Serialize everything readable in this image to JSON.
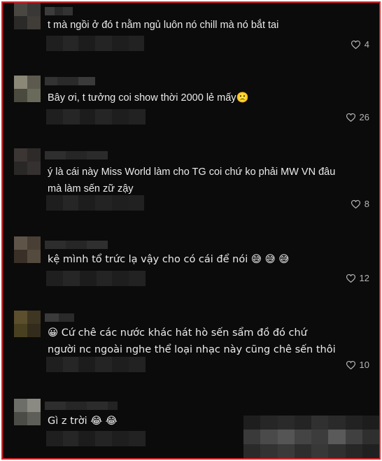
{
  "comments": [
    {
      "text": "t mà ngồi ở đó t nằm ngủ luôn nó chill mà nó bắt tai",
      "likes": "4"
    },
    {
      "text": "Bây ơi, t tưởng coi show thời 2000 lẻ mấy🙁",
      "likes": "26"
    },
    {
      "text": "ý là cái này Miss World làm cho TG coi chứ ko phải MW VN đâu mà làm sến zữ zậy",
      "likes": "8"
    },
    {
      "text": "kệ mình tổ trức lạ vậy cho có cái để nói 😅 😅 😅",
      "likes": "12"
    },
    {
      "text": "😀 Cứ chê các nước khác hát hò sến sẩm đồ đó chứ người nc ngoài nghe thể loại nhạc này cũng chê sến thôi",
      "likes": "10"
    },
    {
      "text": "Gì z trời 😂 😂",
      "likes": ""
    }
  ],
  "icons": {
    "like": "heart-outline-icon"
  },
  "colors": {
    "background": "#0b0b0b",
    "border": "#e0252b",
    "text": "#ebebeb",
    "muted": "#b6b6b6"
  }
}
